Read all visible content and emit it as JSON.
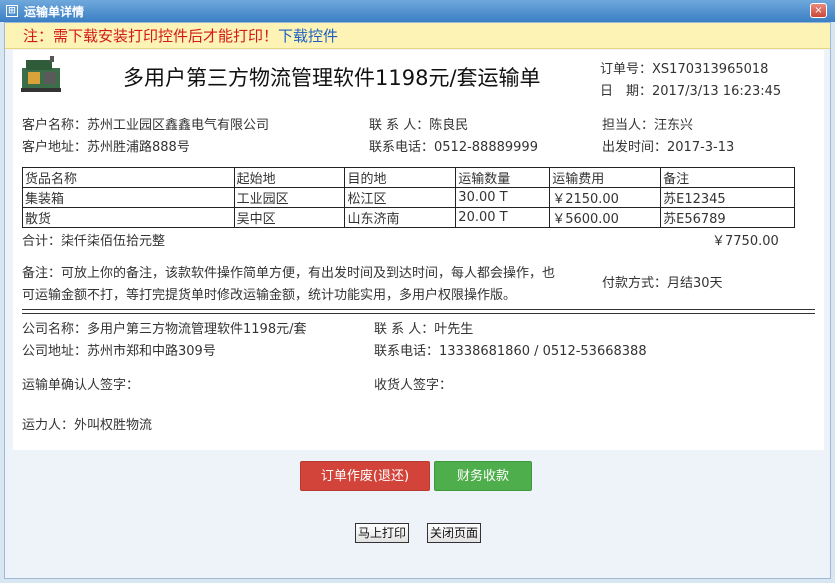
{
  "window": {
    "title": "运输单详情",
    "close_label": "×"
  },
  "warning": {
    "text": "注：需下载安装打印控件后才能打印！",
    "link": "下载控件"
  },
  "doc": {
    "title": "多用户第三方物流管理软件1198元/套运输单",
    "order_no_label": "订单号：",
    "order_no": "XS170313965018",
    "date_label": "日　期：",
    "date": "2017/3/13 16:23:45"
  },
  "customer": {
    "name_label": "客户名称：",
    "name": "苏州工业园区鑫鑫电气有限公司",
    "contact_label": "联 系 人：",
    "contact": "陈良民",
    "handler_label": "担当人：",
    "handler": "汪东兴",
    "address_label": "客户地址：",
    "address": "苏州胜浦路888号",
    "phone_label": "联系电话：",
    "phone": "0512-88889999",
    "depart_label": "出发时间：",
    "depart": "2017-3-13"
  },
  "goods": {
    "headers": [
      "货品名称",
      "起始地",
      "目的地",
      "运输数量",
      "运输费用",
      "备注"
    ],
    "rows": [
      [
        "集装箱",
        "工业园区",
        "松江区",
        "30.00 T",
        "￥2150.00",
        "苏E12345"
      ],
      [
        "散货",
        "吴中区",
        "山东济南",
        "20.00 T",
        "￥5600.00",
        "苏E56789"
      ]
    ]
  },
  "total": {
    "label": "合计：柒仟柒佰伍拾元整",
    "amount": "￥7750.00"
  },
  "remark": {
    "line1": "备注：可放上你的备注，该款软件操作简单方便，有出发时间及到达时间，每人都会操作，也",
    "line2": "可运输金额不打，等打完提货单时修改运输金额，统计功能实用，多用户权限操作版。",
    "payment": "付款方式：月结30天"
  },
  "company": {
    "name_label": "公司名称：",
    "name": "多用户第三方物流管理软件1198元/套",
    "contact_label": "联 系 人：",
    "contact": "叶先生",
    "address_label": "公司地址：",
    "address": "苏州市郑和中路309号",
    "phone_label": "联系电话：",
    "phone": "13338681860 / 0512-53668388"
  },
  "signatures": {
    "confirm": "运输单确认人签字：",
    "receiver": "收货人签字：",
    "carrier": "运力人：外叫权胜物流"
  },
  "buttons": {
    "void": "订单作废(退还)",
    "collect": "财务收款",
    "print": "马上打印",
    "close": "关闭页面"
  },
  "colors": {
    "void_button": "#d2433a",
    "collect_button": "#4fae4c",
    "warning_text": "#d31a1a",
    "link": "#1f5fc4"
  }
}
